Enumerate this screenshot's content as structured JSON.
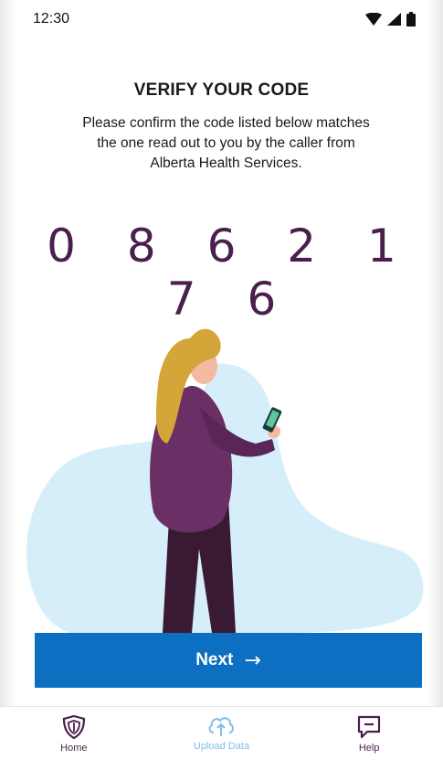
{
  "status_bar": {
    "time": "12:30",
    "icons": [
      "wifi-icon",
      "cellular-signal-icon",
      "battery-icon"
    ]
  },
  "screen": {
    "title": "VERIFY YOUR CODE",
    "instructions": "Please confirm the code listed below matches the one read out to you by the caller from Alberta Health Services.",
    "code": "0 8 6 2 1 7 6"
  },
  "illustration": {
    "icon": "woman-with-phone-illustration"
  },
  "actions": {
    "next_label": "Next",
    "next_arrow": "→"
  },
  "bottom_nav": {
    "items": [
      {
        "label": "Home",
        "icon": "shield-icon",
        "active": true
      },
      {
        "label": "Upload Data",
        "icon": "cloud-upload-icon",
        "active": false
      },
      {
        "label": "Help",
        "icon": "chat-bubble-icon",
        "active": false
      }
    ]
  },
  "colors": {
    "primary_button": "#0c6fc2",
    "code_color": "#4a1f4c",
    "nav_active": "#4a1f4c",
    "nav_inactive_upload": "#7fbfe6",
    "blob": "#d6eef9"
  }
}
